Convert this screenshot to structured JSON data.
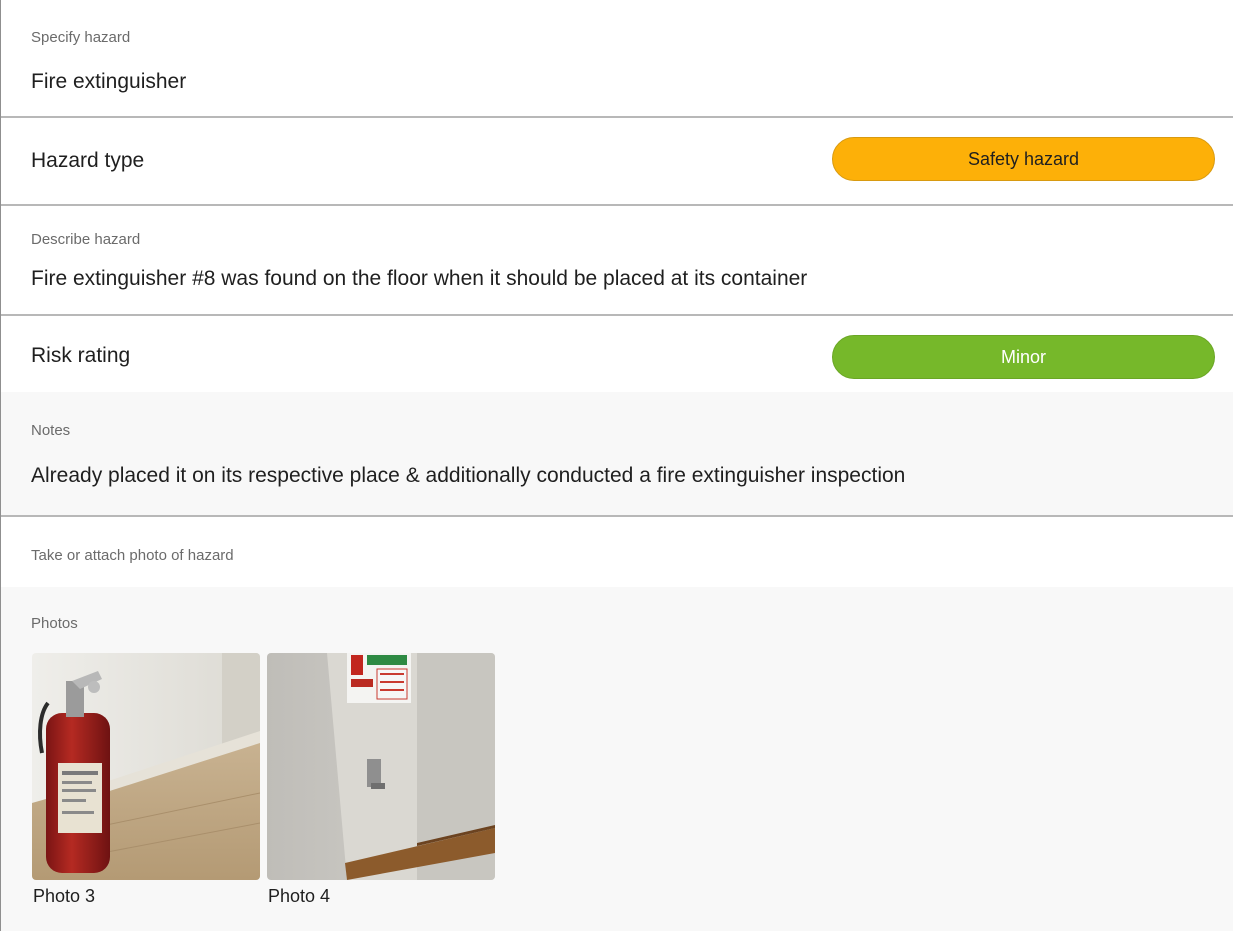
{
  "specify_hazard": {
    "label": "Specify hazard",
    "value": "Fire extinguisher"
  },
  "hazard_type": {
    "label": "Hazard type",
    "value": "Safety hazard",
    "color": "#fdb008"
  },
  "describe_hazard": {
    "label": "Describe hazard",
    "value": "Fire extinguisher #8 was found on the floor when it should be placed at its container"
  },
  "risk_rating": {
    "label": "Risk rating",
    "value": "Minor",
    "color": "#76b82a"
  },
  "notes": {
    "label": "Notes",
    "value": "Already placed it on its respective place & additionally conducted a fire extinguisher inspection"
  },
  "photo_prompt": {
    "label": "Take or attach photo of hazard"
  },
  "photos": {
    "label": "Photos",
    "items": [
      {
        "caption": "Photo 3"
      },
      {
        "caption": "Photo 4"
      }
    ]
  }
}
